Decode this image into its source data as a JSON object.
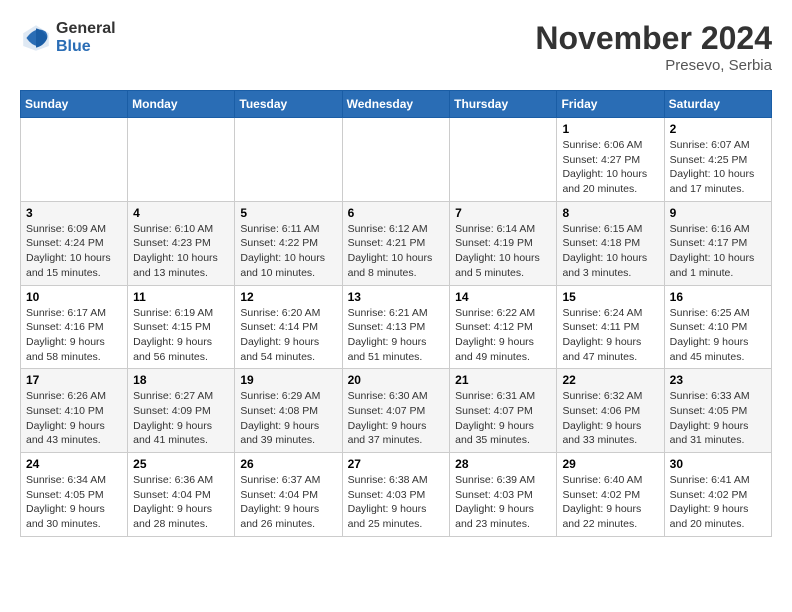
{
  "header": {
    "logo_general": "General",
    "logo_blue": "Blue",
    "month_title": "November 2024",
    "location": "Presevo, Serbia"
  },
  "weekdays": [
    "Sunday",
    "Monday",
    "Tuesday",
    "Wednesday",
    "Thursday",
    "Friday",
    "Saturday"
  ],
  "weeks": [
    [
      {
        "day": "",
        "info": ""
      },
      {
        "day": "",
        "info": ""
      },
      {
        "day": "",
        "info": ""
      },
      {
        "day": "",
        "info": ""
      },
      {
        "day": "",
        "info": ""
      },
      {
        "day": "1",
        "info": "Sunrise: 6:06 AM\nSunset: 4:27 PM\nDaylight: 10 hours and 20 minutes."
      },
      {
        "day": "2",
        "info": "Sunrise: 6:07 AM\nSunset: 4:25 PM\nDaylight: 10 hours and 17 minutes."
      }
    ],
    [
      {
        "day": "3",
        "info": "Sunrise: 6:09 AM\nSunset: 4:24 PM\nDaylight: 10 hours and 15 minutes."
      },
      {
        "day": "4",
        "info": "Sunrise: 6:10 AM\nSunset: 4:23 PM\nDaylight: 10 hours and 13 minutes."
      },
      {
        "day": "5",
        "info": "Sunrise: 6:11 AM\nSunset: 4:22 PM\nDaylight: 10 hours and 10 minutes."
      },
      {
        "day": "6",
        "info": "Sunrise: 6:12 AM\nSunset: 4:21 PM\nDaylight: 10 hours and 8 minutes."
      },
      {
        "day": "7",
        "info": "Sunrise: 6:14 AM\nSunset: 4:19 PM\nDaylight: 10 hours and 5 minutes."
      },
      {
        "day": "8",
        "info": "Sunrise: 6:15 AM\nSunset: 4:18 PM\nDaylight: 10 hours and 3 minutes."
      },
      {
        "day": "9",
        "info": "Sunrise: 6:16 AM\nSunset: 4:17 PM\nDaylight: 10 hours and 1 minute."
      }
    ],
    [
      {
        "day": "10",
        "info": "Sunrise: 6:17 AM\nSunset: 4:16 PM\nDaylight: 9 hours and 58 minutes."
      },
      {
        "day": "11",
        "info": "Sunrise: 6:19 AM\nSunset: 4:15 PM\nDaylight: 9 hours and 56 minutes."
      },
      {
        "day": "12",
        "info": "Sunrise: 6:20 AM\nSunset: 4:14 PM\nDaylight: 9 hours and 54 minutes."
      },
      {
        "day": "13",
        "info": "Sunrise: 6:21 AM\nSunset: 4:13 PM\nDaylight: 9 hours and 51 minutes."
      },
      {
        "day": "14",
        "info": "Sunrise: 6:22 AM\nSunset: 4:12 PM\nDaylight: 9 hours and 49 minutes."
      },
      {
        "day": "15",
        "info": "Sunrise: 6:24 AM\nSunset: 4:11 PM\nDaylight: 9 hours and 47 minutes."
      },
      {
        "day": "16",
        "info": "Sunrise: 6:25 AM\nSunset: 4:10 PM\nDaylight: 9 hours and 45 minutes."
      }
    ],
    [
      {
        "day": "17",
        "info": "Sunrise: 6:26 AM\nSunset: 4:10 PM\nDaylight: 9 hours and 43 minutes."
      },
      {
        "day": "18",
        "info": "Sunrise: 6:27 AM\nSunset: 4:09 PM\nDaylight: 9 hours and 41 minutes."
      },
      {
        "day": "19",
        "info": "Sunrise: 6:29 AM\nSunset: 4:08 PM\nDaylight: 9 hours and 39 minutes."
      },
      {
        "day": "20",
        "info": "Sunrise: 6:30 AM\nSunset: 4:07 PM\nDaylight: 9 hours and 37 minutes."
      },
      {
        "day": "21",
        "info": "Sunrise: 6:31 AM\nSunset: 4:07 PM\nDaylight: 9 hours and 35 minutes."
      },
      {
        "day": "22",
        "info": "Sunrise: 6:32 AM\nSunset: 4:06 PM\nDaylight: 9 hours and 33 minutes."
      },
      {
        "day": "23",
        "info": "Sunrise: 6:33 AM\nSunset: 4:05 PM\nDaylight: 9 hours and 31 minutes."
      }
    ],
    [
      {
        "day": "24",
        "info": "Sunrise: 6:34 AM\nSunset: 4:05 PM\nDaylight: 9 hours and 30 minutes."
      },
      {
        "day": "25",
        "info": "Sunrise: 6:36 AM\nSunset: 4:04 PM\nDaylight: 9 hours and 28 minutes."
      },
      {
        "day": "26",
        "info": "Sunrise: 6:37 AM\nSunset: 4:04 PM\nDaylight: 9 hours and 26 minutes."
      },
      {
        "day": "27",
        "info": "Sunrise: 6:38 AM\nSunset: 4:03 PM\nDaylight: 9 hours and 25 minutes."
      },
      {
        "day": "28",
        "info": "Sunrise: 6:39 AM\nSunset: 4:03 PM\nDaylight: 9 hours and 23 minutes."
      },
      {
        "day": "29",
        "info": "Sunrise: 6:40 AM\nSunset: 4:02 PM\nDaylight: 9 hours and 22 minutes."
      },
      {
        "day": "30",
        "info": "Sunrise: 6:41 AM\nSunset: 4:02 PM\nDaylight: 9 hours and 20 minutes."
      }
    ]
  ]
}
